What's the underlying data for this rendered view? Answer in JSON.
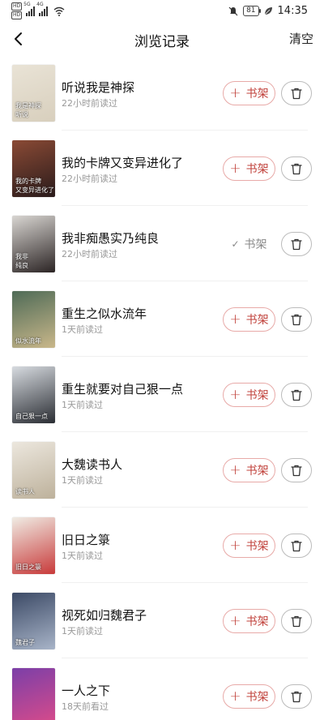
{
  "status_bar": {
    "badges": [
      "HD",
      "HD"
    ],
    "network_tags": [
      "5G",
      "4G"
    ],
    "battery": "81",
    "time": "14:35",
    "icons": [
      "mute-bell-icon",
      "leaf-icon",
      "wifi-icon"
    ]
  },
  "header": {
    "title": "浏览记录",
    "clear_label": "清空"
  },
  "list": {
    "add_label": "书架",
    "added_label": "书架",
    "items": [
      {
        "title": "听说我是神探",
        "time": "22小时前读过",
        "on_shelf": false,
        "cover_text": [
          "我是神探",
          "听说"
        ],
        "cover_colors": [
          "#e9e3d6",
          "#d8cfbd"
        ]
      },
      {
        "title": "我的卡牌又变异进化了",
        "time": "22小时前读过",
        "on_shelf": false,
        "cover_text": [
          "我的卡牌",
          "又变异进化了"
        ],
        "cover_colors": [
          "#8a4a35",
          "#2a1b1b"
        ]
      },
      {
        "title": "我非痴愚实乃纯良",
        "time": "22小时前读过",
        "on_shelf": true,
        "cover_text": [
          "我非",
          "纯良"
        ],
        "cover_colors": [
          "#d9d6d2",
          "#2b2424"
        ]
      },
      {
        "title": "重生之似水流年",
        "time": "1天前读过",
        "on_shelf": false,
        "cover_text": [
          "似水流年"
        ],
        "cover_colors": [
          "#4f6b57",
          "#c9b78a"
        ]
      },
      {
        "title": "重生就要对自己狠一点",
        "time": "1天前读过",
        "on_shelf": false,
        "cover_text": [
          "自己狠一点"
        ],
        "cover_colors": [
          "#d7dbe0",
          "#2a2d33"
        ]
      },
      {
        "title": "大魏读书人",
        "time": "1天前读过",
        "on_shelf": false,
        "cover_text": [
          "读书人"
        ],
        "cover_colors": [
          "#ece7de",
          "#bdb19b"
        ]
      },
      {
        "title": "旧日之箓",
        "time": "1天前读过",
        "on_shelf": false,
        "cover_text": [
          "旧日之箓"
        ],
        "cover_colors": [
          "#f0ece4",
          "#c83a3a"
        ]
      },
      {
        "title": "视死如归魏君子",
        "time": "1天前读过",
        "on_shelf": false,
        "cover_text": [
          "魏君子"
        ],
        "cover_colors": [
          "#3c4a66",
          "#a8b4c8"
        ]
      },
      {
        "title": "一人之下",
        "time": "18天前看过",
        "on_shelf": false,
        "cover_text": [],
        "cover_colors": [
          "#7b3fa8",
          "#d94b8a"
        ]
      }
    ]
  }
}
